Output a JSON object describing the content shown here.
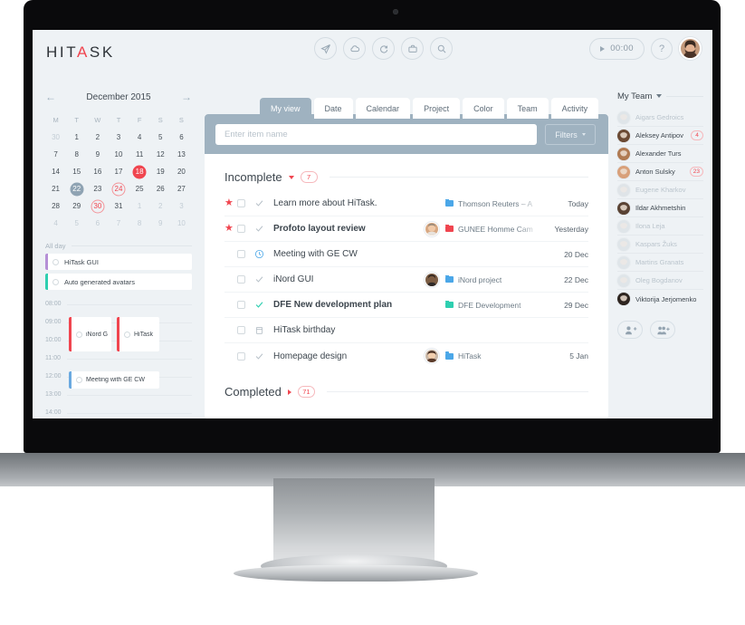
{
  "app": {
    "logo_pre": "HIT",
    "logo_accent": "A",
    "logo_post": "SK"
  },
  "header": {
    "tools": [
      {
        "name": "send-icon",
        "label": "Send"
      },
      {
        "name": "cloud-icon",
        "label": "Cloud"
      },
      {
        "name": "refresh-icon",
        "label": "Refresh"
      },
      {
        "name": "briefcase-icon",
        "label": "Briefcase"
      },
      {
        "name": "search-icon",
        "label": "Search"
      }
    ],
    "timer": "00:00",
    "help": "?",
    "avatar_name": "user-avatar"
  },
  "tabs": [
    {
      "label": "My view",
      "active": true
    },
    {
      "label": "Date",
      "active": false
    },
    {
      "label": "Calendar",
      "active": false
    },
    {
      "label": "Project",
      "active": false
    },
    {
      "label": "Color",
      "active": false
    },
    {
      "label": "Team",
      "active": false
    },
    {
      "label": "Activity",
      "active": false
    }
  ],
  "search": {
    "placeholder": "Enter item name",
    "value": "",
    "filters_label": "Filters"
  },
  "sections": {
    "incomplete": {
      "title": "Incomplete",
      "count": "7",
      "expanded": true
    },
    "completed": {
      "title": "Completed",
      "count": "71",
      "expanded": false
    }
  },
  "tasks": [
    {
      "starred": true,
      "icon": "check",
      "name": "Learn more about HiTask.",
      "bold": false,
      "avatar": false,
      "project": "Thomson Reuters – A",
      "project_color": "#4ba7e8",
      "due": "Today"
    },
    {
      "starred": true,
      "icon": "check",
      "name": "Profoto layout review",
      "bold": true,
      "avatar": true,
      "project": "GUNEE Homme Cam",
      "project_color": "#f0454f",
      "due": "Yesterday"
    },
    {
      "starred": false,
      "icon": "clock",
      "name": "Meeting with GE CW",
      "bold": false,
      "avatar": false,
      "project": "",
      "project_color": "",
      "due": "20 Dec"
    },
    {
      "starred": false,
      "icon": "check",
      "name": "iNord GUI",
      "bold": false,
      "avatar": true,
      "project": "iNord project",
      "project_color": "#4ba7e8",
      "due": "22 Dec"
    },
    {
      "starred": false,
      "icon": "check-teal",
      "name": "DFE New development plan",
      "bold": true,
      "avatar": false,
      "project": "DFE Development",
      "project_color": "#2ecfb0",
      "due": "29 Dec"
    },
    {
      "starred": false,
      "icon": "calendar",
      "name": "HiTask birthday",
      "bold": false,
      "avatar": false,
      "project": "",
      "project_color": "",
      "due": ""
    },
    {
      "starred": false,
      "icon": "check",
      "name": "Homepage design",
      "bold": false,
      "avatar": true,
      "project": "HiTask",
      "project_color": "#4ba7e8",
      "due": "5 Jan"
    }
  ],
  "calendar": {
    "title": "December 2015",
    "prev": "←",
    "next": "→",
    "dow": [
      "M",
      "T",
      "W",
      "T",
      "F",
      "S",
      "S"
    ],
    "days": [
      {
        "n": "30",
        "style": "mute"
      },
      {
        "n": "1",
        "style": ""
      },
      {
        "n": "2",
        "style": ""
      },
      {
        "n": "3",
        "style": ""
      },
      {
        "n": "4",
        "style": ""
      },
      {
        "n": "5",
        "style": ""
      },
      {
        "n": "6",
        "style": ""
      },
      {
        "n": "7",
        "style": ""
      },
      {
        "n": "8",
        "style": ""
      },
      {
        "n": "9",
        "style": ""
      },
      {
        "n": "10",
        "style": ""
      },
      {
        "n": "11",
        "style": ""
      },
      {
        "n": "12",
        "style": ""
      },
      {
        "n": "13",
        "style": ""
      },
      {
        "n": "14",
        "style": ""
      },
      {
        "n": "15",
        "style": ""
      },
      {
        "n": "16",
        "style": ""
      },
      {
        "n": "17",
        "style": ""
      },
      {
        "n": "18",
        "style": "fill-red"
      },
      {
        "n": "19",
        "style": ""
      },
      {
        "n": "20",
        "style": ""
      },
      {
        "n": "21",
        "style": ""
      },
      {
        "n": "22",
        "style": "fill-blue"
      },
      {
        "n": "23",
        "style": ""
      },
      {
        "n": "24",
        "style": "ring-red"
      },
      {
        "n": "25",
        "style": ""
      },
      {
        "n": "26",
        "style": ""
      },
      {
        "n": "27",
        "style": ""
      },
      {
        "n": "28",
        "style": ""
      },
      {
        "n": "29",
        "style": ""
      },
      {
        "n": "30",
        "style": "ring-red"
      },
      {
        "n": "31",
        "style": ""
      },
      {
        "n": "1",
        "style": "mute"
      },
      {
        "n": "2",
        "style": "mute"
      },
      {
        "n": "3",
        "style": "mute"
      },
      {
        "n": "4",
        "style": "mute"
      },
      {
        "n": "5",
        "style": "mute"
      },
      {
        "n": "6",
        "style": "mute"
      },
      {
        "n": "7",
        "style": "mute"
      },
      {
        "n": "8",
        "style": "mute"
      },
      {
        "n": "9",
        "style": "mute"
      },
      {
        "n": "10",
        "style": "mute"
      }
    ],
    "allday_label": "All day",
    "allday_events": [
      {
        "title": "HiTask GUI",
        "color": "#b58fd6"
      },
      {
        "title": "Auto generated avatars",
        "color": "#2ecfb0"
      }
    ],
    "times": [
      "08:00",
      "09:00",
      "10:00",
      "11:00",
      "12:00",
      "13:00",
      "14:00"
    ],
    "timed_events": [
      {
        "title": "iNord G",
        "color": "#f0454f"
      },
      {
        "title": "HiTask",
        "color": "#f0454f"
      }
    ],
    "noon_event": {
      "title": "Meeting with GE CW",
      "color": "#6aa9e0"
    }
  },
  "team": {
    "title": "My Team",
    "members": [
      {
        "name": "Aigars Gedroics",
        "online": false,
        "badge": ""
      },
      {
        "name": "Aleksey Antipov",
        "online": true,
        "badge": "4"
      },
      {
        "name": "Alexander Turs",
        "online": true,
        "badge": ""
      },
      {
        "name": "Anton Sulsky",
        "online": true,
        "badge": "23"
      },
      {
        "name": "Eugene Kharkov",
        "online": false,
        "badge": ""
      },
      {
        "name": "Ildar Akhmetshin",
        "online": true,
        "badge": ""
      },
      {
        "name": "Ilona Leja",
        "online": false,
        "badge": ""
      },
      {
        "name": "Kaspars Žuks",
        "online": false,
        "badge": ""
      },
      {
        "name": "Martins Granats",
        "online": false,
        "badge": ""
      },
      {
        "name": "Oleg Bogdanov",
        "online": false,
        "badge": ""
      },
      {
        "name": "Viktorija Jerjomenko",
        "online": true,
        "badge": ""
      }
    ],
    "actions": [
      {
        "name": "add-person-icon"
      },
      {
        "name": "add-team-icon"
      }
    ]
  },
  "colors": {
    "accent_red": "#f0454f",
    "panel_blue": "#9fb2c0",
    "bg": "#eef2f5",
    "teal": "#2ecfb0",
    "blue": "#4ba7e8"
  }
}
